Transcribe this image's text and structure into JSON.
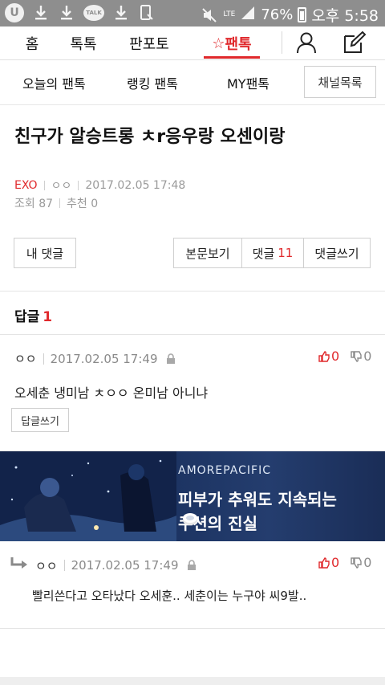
{
  "status_bar": {
    "battery": "76%",
    "time": "오후 5:58",
    "network": "LTE",
    "talk_badge": "TALK"
  },
  "top_nav": {
    "tabs": [
      "홈",
      "톡톡",
      "판포토",
      "팬톡"
    ],
    "active_prefix": "☆"
  },
  "sub_nav": {
    "items": [
      "오늘의 팬톡",
      "랭킹 팬톡",
      "MY팬톡"
    ],
    "channel_list_button": "채널목록"
  },
  "article": {
    "title": "친구가 알승트롱 ㅊr응우랑 오센이랑",
    "category": "EXO",
    "author": "ㅇㅇ",
    "date": "2017.02.05 17:48",
    "views_label": "조회 87",
    "recommend_label": "추천 0"
  },
  "actions": {
    "my_comments": "내 댓글",
    "view_body": "본문보기",
    "comments_label": "댓글",
    "comments_count": "11",
    "write_comment": "댓글쓰기"
  },
  "replies": {
    "heading": "답글",
    "count": "1"
  },
  "comments": [
    {
      "author": "ㅇㅇ",
      "date": "2017.02.05 17:49",
      "text": "오세춘 냉미남 ㅊㅇㅇ 온미남 아니냐",
      "up": "0",
      "down": "0",
      "reply_button": "답글쓰기"
    },
    {
      "author": "ㅇㅇ",
      "date": "2017.02.05 17:49",
      "text": "빨리쓴다고 오타났다 오세훈.. 세춘이는 누구야 씨9발..",
      "up": "0",
      "down": "0"
    }
  ],
  "ad_banner": {
    "brand": "AMOREPACIFIC",
    "line1": "피부가 추워도 지속되는",
    "line2": "쿠션의 진실"
  },
  "colors": {
    "accent": "#e0292c",
    "status_bar": "#8e8e8e",
    "banner_bg": "#1b3260"
  }
}
